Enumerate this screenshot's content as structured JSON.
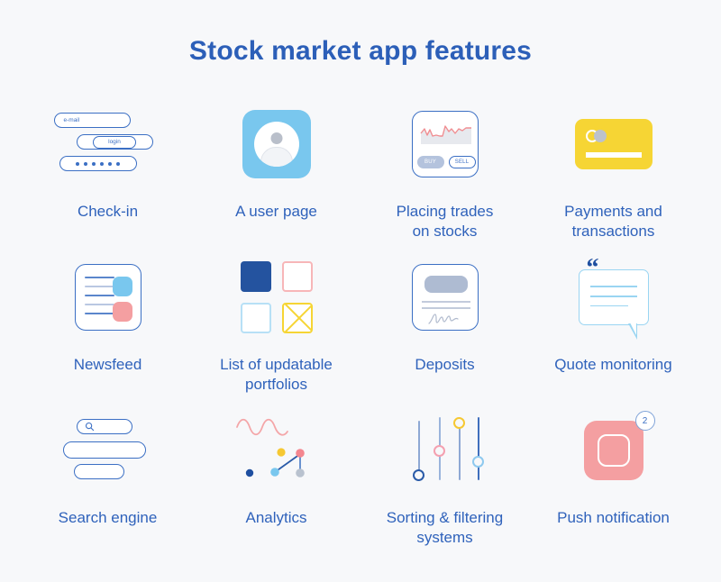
{
  "page": {
    "title": "Stock market app features",
    "accent_blue": "#2c5fb8",
    "background": "#f7f8fa"
  },
  "features": [
    {
      "id": "check-in",
      "label": "Check-in",
      "icon": "login-form-icon",
      "fields": {
        "email": "e-mail",
        "login": "login",
        "password_dots": 6
      }
    },
    {
      "id": "a-user-page",
      "label": "A user page",
      "icon": "user-avatar-icon",
      "colors": {
        "tile": "#79c7ee",
        "avatar": "#b9bfca"
      }
    },
    {
      "id": "placing-trades-on-stocks",
      "label": "Placing trades\non stocks",
      "icon": "trade-card-icon",
      "buttons": {
        "buy": "BUY",
        "sell": "SELL"
      },
      "colors": {
        "line": "#f08e92",
        "buy_bg": "#b4c3dd",
        "border": "#3b6fc4"
      }
    },
    {
      "id": "payments-and-transactions",
      "label": "Payments and\ntransactions",
      "icon": "credit-card-icon",
      "colors": {
        "card": "#f6d534",
        "chip": "#bcc2cc"
      }
    },
    {
      "id": "newsfeed",
      "label": "Newsfeed",
      "icon": "newsfeed-icon",
      "colors": {
        "tile_blue": "#79c7ee",
        "tile_pink": "#f49fa1"
      },
      "text_lines": 5
    },
    {
      "id": "list-of-updatable-portfolios",
      "label": "List of updatable\nportfolios",
      "icon": "portfolio-grid-icon",
      "colors": {
        "filled": "#24539f",
        "pink": "#f7b6b8",
        "light_blue": "#b7e0f6",
        "yellow": "#f6d534"
      }
    },
    {
      "id": "deposits",
      "label": "Deposits",
      "icon": "signed-document-icon",
      "colors": {
        "block": "#aebbd2",
        "border": "#3b6fc4"
      }
    },
    {
      "id": "quote-monitoring",
      "label": "Quote monitoring",
      "icon": "speech-bubble-quote-icon",
      "quote_mark": "“",
      "colors": {
        "bubble": "#9ad5f2",
        "quote": "#1f4fa0"
      },
      "text_lines": 3
    },
    {
      "id": "search-engine",
      "label": "Search engine",
      "icon": "search-bar-icon",
      "glyph": "⌕",
      "colors": {
        "outline": "#3b6fc4"
      }
    },
    {
      "id": "analytics",
      "label": "Analytics",
      "icon": "scatter-wave-icon",
      "colors": {
        "wave": "#f4a6a8",
        "navy": "#1f4fa0",
        "yellow": "#f6c832",
        "light_blue": "#79c7ee",
        "pink": "#f4868f",
        "gray": "#b9c2cf"
      }
    },
    {
      "id": "sorting-filtering-systems",
      "label": "Sorting & filtering\nsystems",
      "icon": "vertical-sliders-icon",
      "sliders": [
        {
          "color": "#2a5ba8",
          "position_pct": 88
        },
        {
          "color": "#f4a0b0",
          "position_pct": 55
        },
        {
          "color": "#f6c832",
          "position_pct": 8
        },
        {
          "color": "#8ec9ef",
          "position_pct": 70
        }
      ]
    },
    {
      "id": "push-notification",
      "label": "Push notification",
      "icon": "app-badge-icon",
      "badge_count": "2",
      "colors": {
        "tile": "#f49fa1",
        "badge_text": "#3b6fc4"
      }
    }
  ]
}
